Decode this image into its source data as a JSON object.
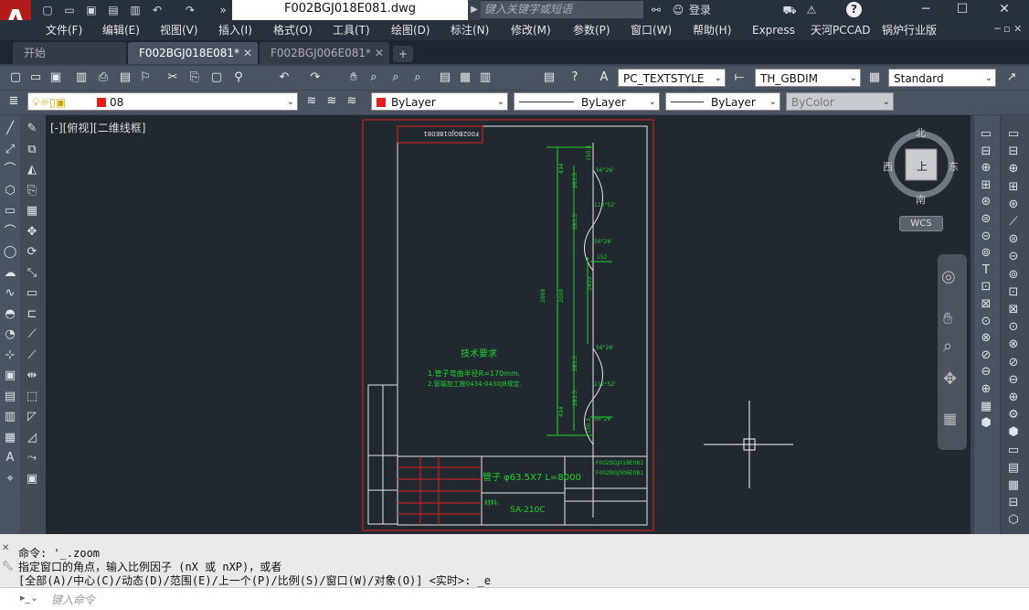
{
  "app": {
    "logo": "A",
    "doc_title": "F002BGJ018E081.dwg"
  },
  "search": {
    "placeholder": "键入关键字或短语"
  },
  "user": {
    "login": "登录"
  },
  "help": {
    "label": "?"
  },
  "menus": [
    "文件(F)",
    "编辑(E)",
    "视图(V)",
    "插入(I)",
    "格式(O)",
    "工具(T)",
    "绘图(D)",
    "标注(N)",
    "修改(M)",
    "参数(P)",
    "窗口(W)",
    "帮助(H)",
    "Express",
    "天河PCCAD",
    "锅炉行业版"
  ],
  "tabs": [
    {
      "label": "开始"
    },
    {
      "label": "F002BGJ018E081*"
    },
    {
      "label": "F002BGJ006E081*"
    }
  ],
  "tab_add": "+",
  "styles": {
    "text_style": "PC_TEXTSTYLE",
    "dim_style": "TH_GBDIM",
    "table_style": "Standard"
  },
  "layer": {
    "name": "08",
    "color": "ByLayer",
    "linetype": "ByLayer",
    "lineweight": "ByLayer",
    "plotstyle": "ByColor"
  },
  "view": {
    "label": "[-][俯视][二维线框]"
  },
  "compass": {
    "north": "北",
    "south": "南",
    "east": "东",
    "west": "西",
    "top": "上",
    "wcs": "WCS"
  },
  "drawing": {
    "name_rev": "F002BGJ018E081",
    "tech_title": "技术要求",
    "tech_req_1": "1.管子弯曲半径R=170mm.",
    "tech_req_2": "2.管端加工按0434-0430JB规定.",
    "pipe_spec": "管子 φ63.5X7 L=8000",
    "material_label": "材料:",
    "material": "SA-210C",
    "part_no_1": "F002BGJ018E081",
    "part_no_2": "F002BGJ006E081",
    "dims": [
      "434",
      "283.5",
      "283.5",
      "150.5",
      "56°26'",
      "112°52'",
      "56°26'",
      "2868",
      "2000",
      "1433",
      "152",
      "56°26'",
      "112°52'",
      "56°26'",
      "283.5",
      "283.5",
      "434",
      "150.5"
    ]
  },
  "command": {
    "history": [
      "命令: '_.zoom",
      "指定窗口的角点，输入比例因子 (nX 或 nXP)，或者",
      "[全部(A)/中心(C)/动态(D)/范围(E)/上一个(P)/比例(S)/窗口(W)/对象(O)] <实时>: _e"
    ],
    "placeholder": "键入命令"
  },
  "colors": {
    "accent": "#b31b1b",
    "canvas": "#212830",
    "frame_red": "#e0201c",
    "line_green": "#1ed42a"
  }
}
